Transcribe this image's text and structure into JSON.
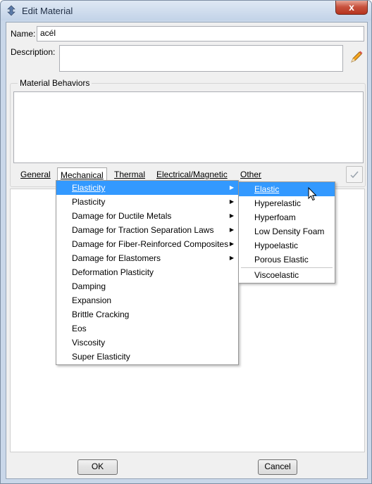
{
  "window": {
    "title": "Edit Material",
    "close_label": "x"
  },
  "name": {
    "label": "Name:",
    "value": "acél"
  },
  "description": {
    "label": "Description:",
    "value": ""
  },
  "behaviors": {
    "title": "Material Behaviors"
  },
  "menubar": {
    "items": [
      {
        "label": "General"
      },
      {
        "label": "Mechanical"
      },
      {
        "label": "Thermal"
      },
      {
        "label": "Electrical/Magnetic"
      },
      {
        "label": "Other"
      }
    ]
  },
  "mechanical_menu": {
    "items": [
      {
        "label": "Elasticity"
      },
      {
        "label": "Plasticity"
      },
      {
        "label": "Damage for Ductile Metals"
      },
      {
        "label": "Damage for Traction Separation Laws"
      },
      {
        "label": "Damage for Fiber-Reinforced Composites"
      },
      {
        "label": "Damage for Elastomers"
      },
      {
        "label": "Deformation Plasticity"
      },
      {
        "label": "Damping"
      },
      {
        "label": "Expansion"
      },
      {
        "label": "Brittle Cracking"
      },
      {
        "label": "Eos"
      },
      {
        "label": "Viscosity"
      },
      {
        "label": "Super Elasticity"
      }
    ]
  },
  "elasticity_menu": {
    "items": [
      {
        "label": "Elastic"
      },
      {
        "label": "Hyperelastic"
      },
      {
        "label": "Hyperfoam"
      },
      {
        "label": "Low Density Foam"
      },
      {
        "label": "Hypoelastic"
      },
      {
        "label": "Porous Elastic"
      },
      {
        "label": "Viscoelastic"
      }
    ]
  },
  "buttons": {
    "ok": "OK",
    "cancel": "Cancel"
  },
  "colors": {
    "highlight": "#3399ff",
    "titlebar": "#c9d7e9"
  }
}
